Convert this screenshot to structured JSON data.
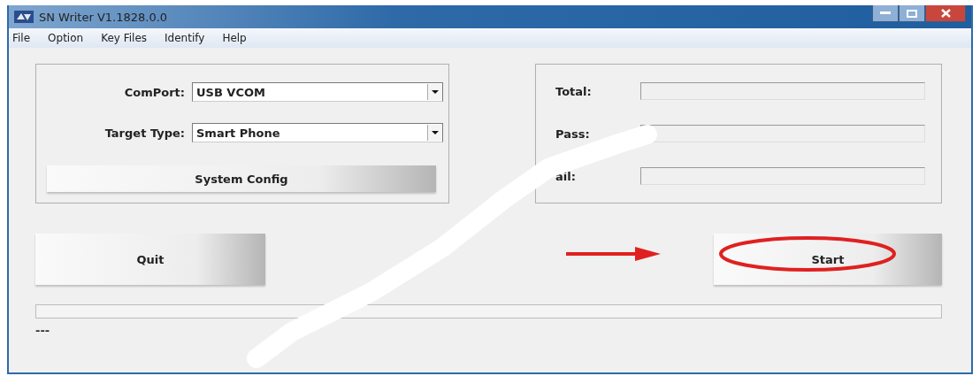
{
  "window": {
    "title": "SN Writer V1.1828.0.0"
  },
  "menu": [
    "File",
    "Option",
    "Key Files",
    "Identify",
    "Help"
  ],
  "settings": [
    {
      "label": "ComPort:",
      "value": "USB VCOM"
    },
    {
      "label": "Target Type:",
      "value": "Smart Phone"
    }
  ],
  "system_config_button": "System Config",
  "counters": [
    {
      "label": "Total:"
    },
    {
      "label": "Pass:"
    },
    {
      "label": "ail:"
    }
  ],
  "quit_button": "Quit",
  "start_button": "Start",
  "status_text": "---"
}
